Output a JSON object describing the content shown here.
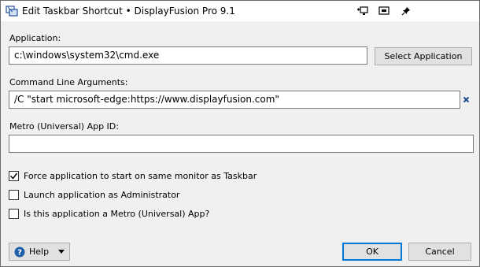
{
  "window": {
    "title": "Edit Taskbar Shortcut • DisplayFusion Pro 9.1"
  },
  "application": {
    "label": "Application:",
    "value": "c:\\windows\\system32\\cmd.exe",
    "select_button": "Select Application"
  },
  "arguments": {
    "label": "Command Line Arguments:",
    "value": "/C \"start microsoft-edge:https://www.displayfusion.com\""
  },
  "metro": {
    "label": "Metro (Universal) App ID:",
    "value": ""
  },
  "options": [
    {
      "label": "Force application to start on same monitor as Taskbar",
      "checked": true
    },
    {
      "label": "Launch application as Administrator",
      "checked": false
    },
    {
      "label": "Is this application a Metro (Universal) App?",
      "checked": false
    }
  ],
  "footer": {
    "help_label": "Help",
    "ok_label": "OK",
    "cancel_label": "Cancel"
  },
  "icons": {
    "app": "displayfusion-icon",
    "titlebar": [
      "monitor-move-icon",
      "screen-icon",
      "pin-icon"
    ],
    "clear": "clear-x-icon",
    "help": "help-icon",
    "dropdown": "triangle-down-icon"
  },
  "colors": {
    "accent": "#0078d7",
    "help_icon": "#1e5fa8",
    "clear_x": "#1e4e8c"
  }
}
